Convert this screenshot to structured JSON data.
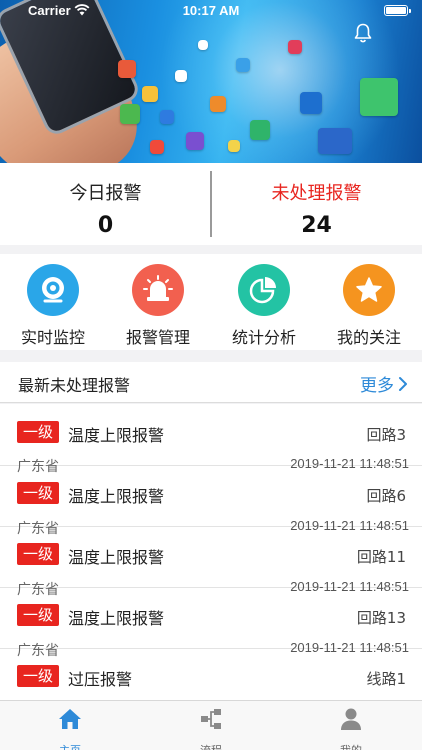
{
  "status_bar": {
    "carrier": "Carrier",
    "time": "10:17 AM"
  },
  "summary": {
    "today_label": "今日报警",
    "today_value": "0",
    "unhandled_label": "未处理报警",
    "unhandled_value": "24"
  },
  "functions": [
    {
      "label": "实时监控",
      "icon": "camera-icon",
      "color": "#2aa6e8"
    },
    {
      "label": "报警管理",
      "icon": "siren-icon",
      "color": "#f2604f"
    },
    {
      "label": "统计分析",
      "icon": "pie-chart-icon",
      "color": "#23c3a4"
    },
    {
      "label": "我的关注",
      "icon": "star-icon",
      "color": "#f5941f"
    }
  ],
  "list_header": {
    "title": "最新未处理报警",
    "more": "更多"
  },
  "alarms": [
    {
      "level": "一级",
      "name": "温度上限报警",
      "circuit": "回路3",
      "province": "广东省",
      "time": "2019-11-21 11:48:51"
    },
    {
      "level": "一级",
      "name": "温度上限报警",
      "circuit": "回路6",
      "province": "广东省",
      "time": "2019-11-21 11:48:51"
    },
    {
      "level": "一级",
      "name": "温度上限报警",
      "circuit": "回路11",
      "province": "广东省",
      "time": "2019-11-21 11:48:51"
    },
    {
      "level": "一级",
      "name": "温度上限报警",
      "circuit": "回路13",
      "province": "广东省",
      "time": "2019-11-21 11:48:51"
    },
    {
      "level": "一级",
      "name": "过压报警",
      "circuit": "线路1",
      "province": "",
      "time": ""
    }
  ],
  "tabs": [
    {
      "label": "主页",
      "icon": "home-icon",
      "active": true
    },
    {
      "label": "流程",
      "icon": "flow-icon",
      "active": false
    },
    {
      "label": "我的",
      "icon": "user-icon",
      "active": false
    }
  ],
  "colors": {
    "accent": "#2e8ad8",
    "alarm_red": "#e8251f"
  }
}
